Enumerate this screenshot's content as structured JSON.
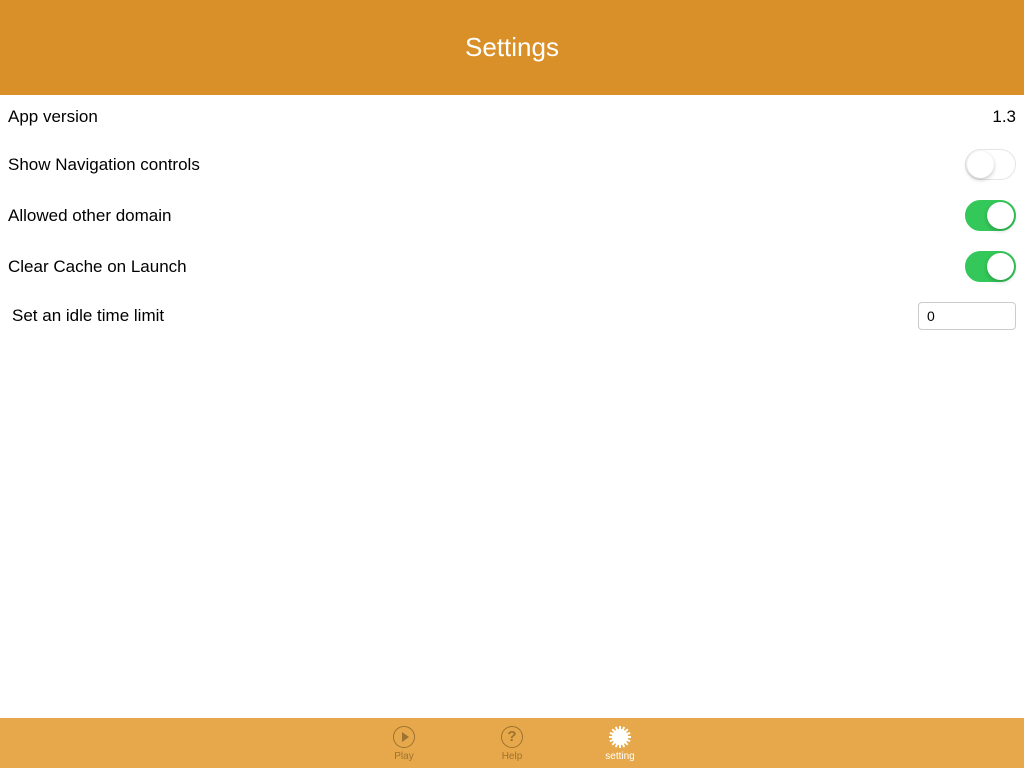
{
  "header": {
    "title": "Settings"
  },
  "rows": {
    "appVersion": {
      "label": "App version",
      "value": "1.3"
    },
    "showNav": {
      "label": "Show Navigation controls",
      "on": false
    },
    "allowedDomain": {
      "label": "Allowed other domain",
      "on": true
    },
    "clearCache": {
      "label": "Clear Cache on Launch",
      "on": true
    },
    "idleTime": {
      "label": "Set an idle time limit",
      "value": "0"
    }
  },
  "tabbar": {
    "play": "Play",
    "help": "Help",
    "setting": "setting"
  },
  "colors": {
    "accent": "#d99028",
    "tabbar": "#e6a84a",
    "toggleOn": "#34c759"
  }
}
